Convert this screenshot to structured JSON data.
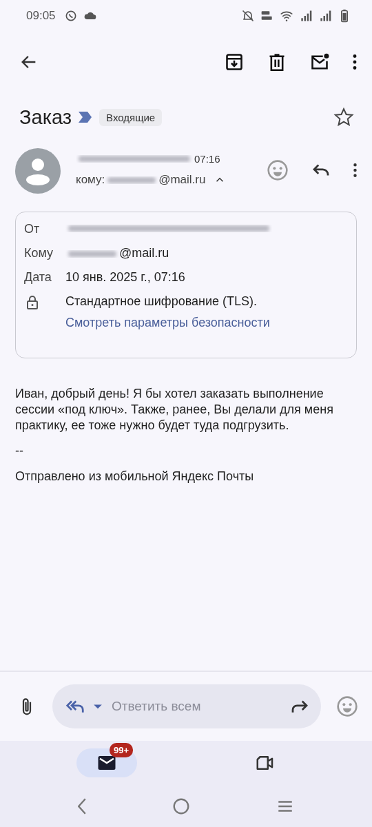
{
  "status_bar": {
    "time": "09:05"
  },
  "subject": {
    "title": "Заказ",
    "label": "Входящие",
    "starred": false
  },
  "sender": {
    "time": "07:16",
    "to_prefix": "кому:",
    "to_suffix": "@mail.ru",
    "expanded": true
  },
  "details": {
    "rows": [
      {
        "kind": "redacted",
        "label": "От"
      },
      {
        "kind": "partial",
        "label": "Кому",
        "value": "@mail.ru"
      },
      {
        "kind": "text",
        "label": "Дата",
        "value": "10 янв. 2025 г., 07:16"
      },
      {
        "kind": "security",
        "value": "Стандартное шифрование (TLS).",
        "link": "Смотреть параметры безопасности"
      }
    ]
  },
  "body": [
    "Иван, добрый день! Я бы хотел заказать выполнение сессии «под ключ». Также, ранее, Вы делали для меня практику, ее тоже нужно будет туда подгрузить.",
    "--",
    "Отправлено из мобильной Яндекс Почты"
  ],
  "reply_bar": {
    "placeholder": "Ответить всем"
  },
  "nav": [
    {
      "kind": "mail",
      "selected": true,
      "badge": "99+"
    },
    {
      "kind": "meet",
      "selected": false
    }
  ]
}
